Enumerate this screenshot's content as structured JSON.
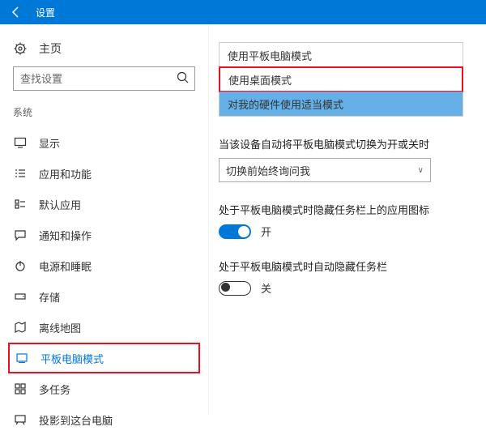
{
  "titlebar": {
    "title": "设置"
  },
  "sidebar": {
    "home": "主页",
    "search_placeholder": "查找设置",
    "category": "系统",
    "items": [
      {
        "label": "显示"
      },
      {
        "label": "应用和功能"
      },
      {
        "label": "默认应用"
      },
      {
        "label": "通知和操作"
      },
      {
        "label": "电源和睡眠"
      },
      {
        "label": "存储"
      },
      {
        "label": "离线地图"
      },
      {
        "label": "平板电脑模式"
      },
      {
        "label": "多任务"
      },
      {
        "label": "投影到这台电脑"
      }
    ]
  },
  "main": {
    "dropdown": {
      "opt1": "使用平板电脑模式",
      "opt2": "使用桌面模式",
      "opt3": "对我的硬件使用适当模式"
    },
    "section1": {
      "title": "当该设备自动将平板电脑模式切换为开或关时",
      "combo_value": "切换前始终询问我"
    },
    "section2": {
      "title": "处于平板电脑模式时隐藏任务栏上的应用图标",
      "toggle_label": "开"
    },
    "section3": {
      "title": "处于平板电脑模式时自动隐藏任务栏",
      "toggle_label": "关"
    }
  }
}
